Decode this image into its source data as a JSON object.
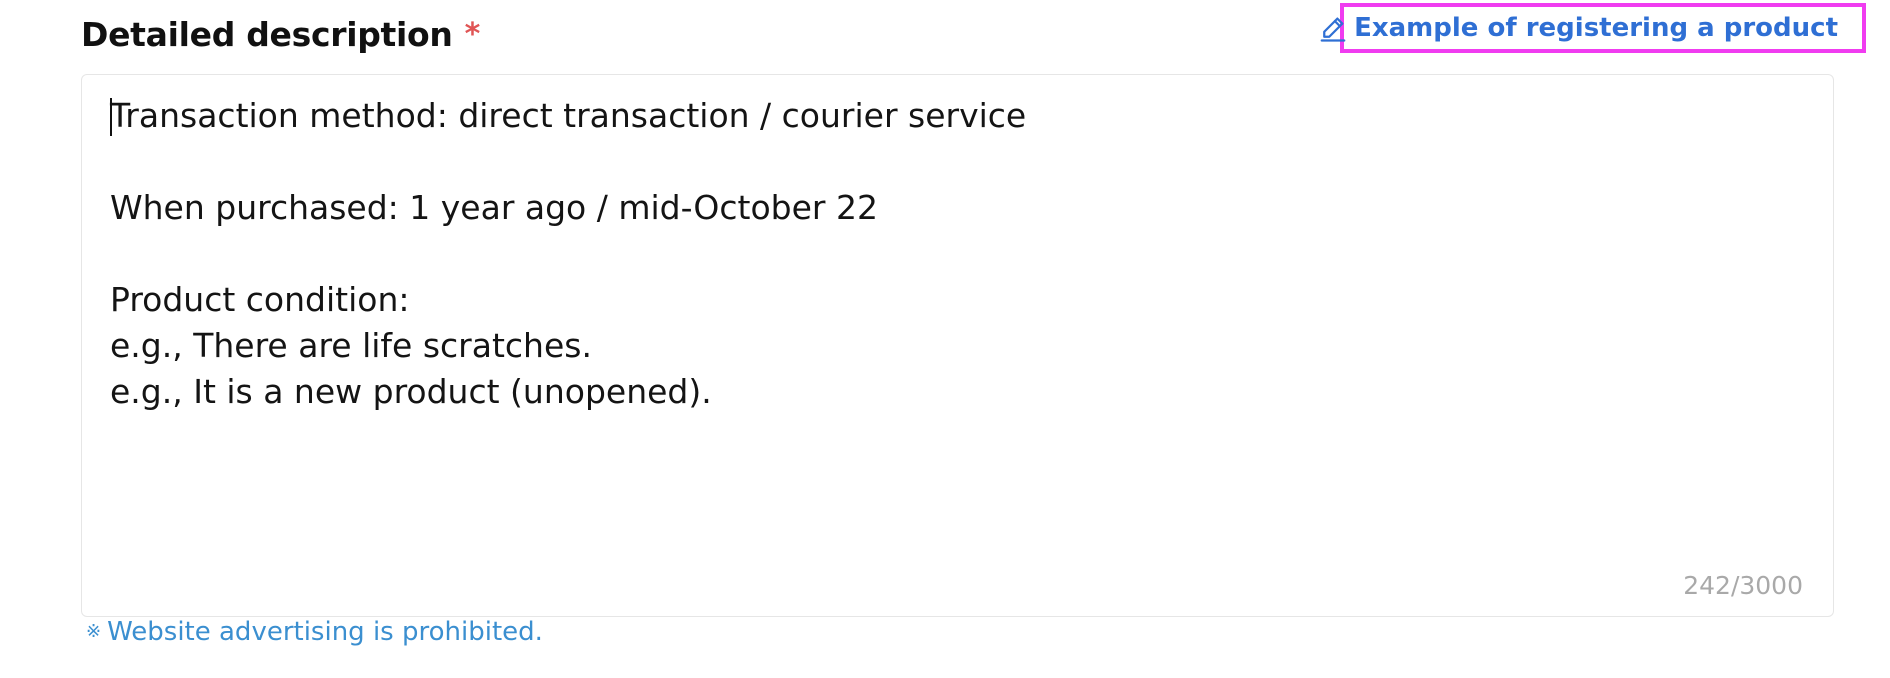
{
  "header": {
    "title": "Detailed description",
    "required_mark": "*"
  },
  "example_link": {
    "label": "Example of registering a product",
    "icon": "pencil-icon",
    "color": "#2f6fd4"
  },
  "editor": {
    "value": "Transaction method: direct transaction / courier service\n\nWhen purchased: 1 year ago / mid-October 22\n\nProduct condition:\ne.g., There are life scratches.\ne.g., It is a new product (unopened).",
    "char_count": "242/3000"
  },
  "notice": {
    "symbol": "※",
    "text": "Website advertising is prohibited.",
    "color": "#3b8fd0"
  },
  "colors": {
    "required": "#e05555",
    "highlight_border": "#f03cf0"
  }
}
